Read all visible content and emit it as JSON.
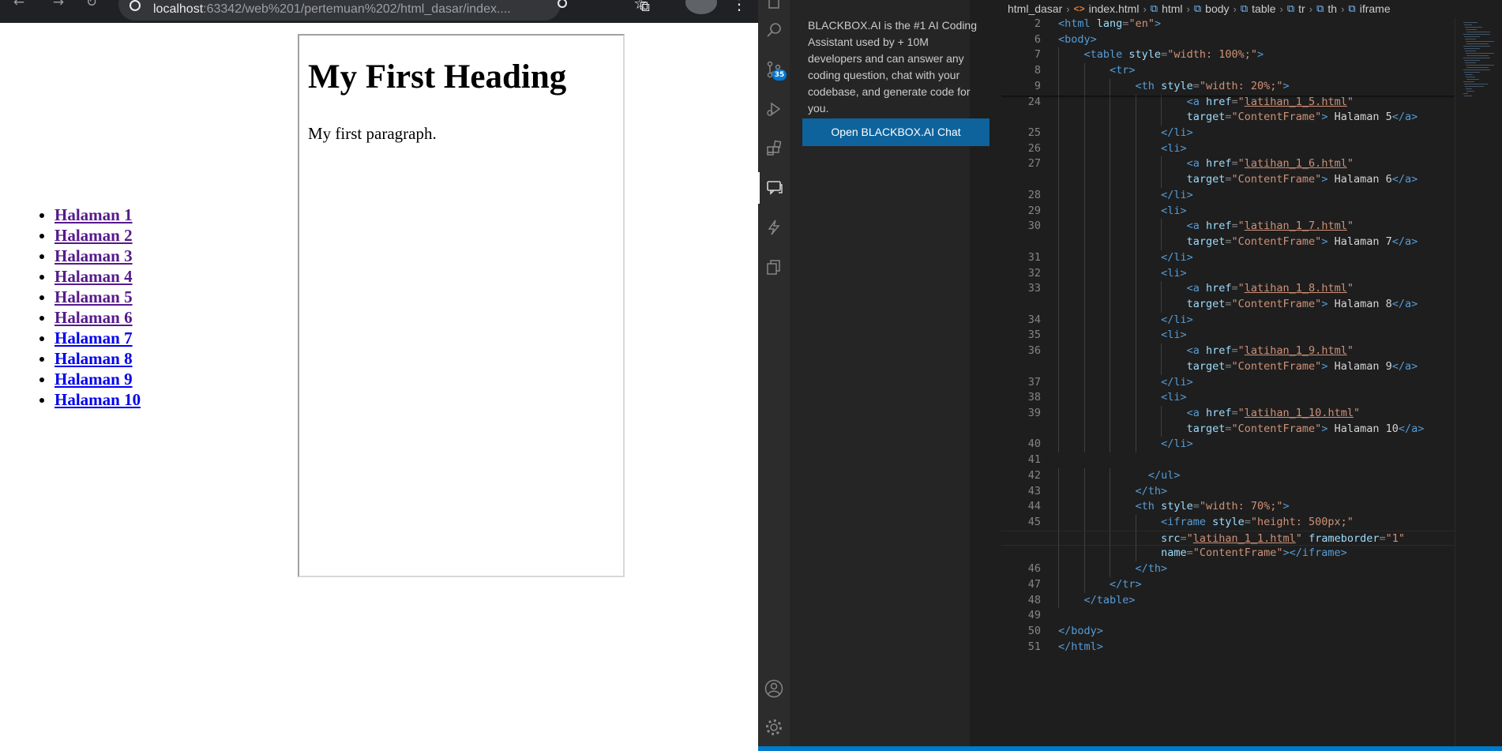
{
  "browser": {
    "url_host": "localhost",
    "url_rest": ":63342/web%201/pertemuan%202/html_dasar/index....",
    "nav_links": [
      {
        "label": "Halaman 1",
        "visited": true
      },
      {
        "label": "Halaman 2",
        "visited": true
      },
      {
        "label": "Halaman 3",
        "visited": true
      },
      {
        "label": "Halaman 4",
        "visited": true
      },
      {
        "label": "Halaman 5",
        "visited": true
      },
      {
        "label": "Halaman 6",
        "visited": true
      },
      {
        "label": "Halaman 7",
        "visited": false
      },
      {
        "label": "Halaman 8",
        "visited": false
      },
      {
        "label": "Halaman 9",
        "visited": false
      },
      {
        "label": "Halaman 10",
        "visited": false
      }
    ],
    "frame": {
      "heading": "My First Heading",
      "paragraph": "My first paragraph."
    }
  },
  "vscode": {
    "activity_bar": {
      "items": [
        "search-icon",
        "source-control-icon",
        "run-debug-icon",
        "extensions-icon",
        "blackbox-chat-icon",
        "lightning-icon",
        "copy-icon"
      ],
      "source_control_badge": "35",
      "bottom": [
        "account-icon",
        "settings-gear-icon"
      ]
    },
    "blackbox": {
      "description": "BLACKBOX.AI is the #1 AI Coding Assistant used by + 10M developers and can answer any coding question, chat with your codebase, and generate code for you.",
      "button_label": "Open BLACKBOX.AI Chat"
    },
    "breadcrumb": [
      "html_dasar",
      "index.html",
      "html",
      "body",
      "table",
      "tr",
      "th",
      "iframe"
    ],
    "code_lines": [
      {
        "n": "2",
        "indent": 0,
        "t": [
          [
            "t",
            "<html "
          ],
          [
            "a",
            "lang"
          ],
          [
            "p",
            "="
          ],
          [
            "s",
            "\"en\""
          ],
          [
            "t",
            ">"
          ]
        ]
      },
      {
        "n": "6",
        "indent": 0,
        "t": [
          [
            "t",
            "<body>"
          ]
        ]
      },
      {
        "n": "7",
        "indent": 1,
        "t": [
          [
            "t",
            "<table "
          ],
          [
            "a",
            "style"
          ],
          [
            "p",
            "="
          ],
          [
            "s",
            "\"width: 100%;\""
          ],
          [
            "t",
            ">"
          ]
        ]
      },
      {
        "n": "8",
        "indent": 2,
        "t": [
          [
            "t",
            "<tr>"
          ]
        ]
      },
      {
        "n": "9",
        "indent": 3,
        "t": [
          [
            "t",
            "<th "
          ],
          [
            "a",
            "style"
          ],
          [
            "p",
            "="
          ],
          [
            "s",
            "\"width: 20%;\""
          ],
          [
            "t",
            ">"
          ]
        ]
      },
      {
        "n": "24",
        "indent": 5,
        "t": [
          [
            "t",
            "<a "
          ],
          [
            "a",
            "href"
          ],
          [
            "p",
            "="
          ],
          [
            "s",
            "\""
          ],
          [
            "l",
            "latihan_1_5.html"
          ],
          [
            "s",
            "\""
          ]
        ]
      },
      {
        "n": "",
        "indent": 5,
        "t": [
          [
            "a",
            "target"
          ],
          [
            "p",
            "="
          ],
          [
            "s",
            "\"ContentFrame\""
          ],
          [
            "t",
            ">"
          ],
          [
            "x",
            " Halaman 5"
          ],
          [
            "t",
            "</a>"
          ]
        ]
      },
      {
        "n": "25",
        "indent": 4,
        "t": [
          [
            "t",
            "</li>"
          ]
        ]
      },
      {
        "n": "26",
        "indent": 4,
        "t": [
          [
            "t",
            "<li>"
          ]
        ]
      },
      {
        "n": "27",
        "indent": 5,
        "t": [
          [
            "t",
            "<a "
          ],
          [
            "a",
            "href"
          ],
          [
            "p",
            "="
          ],
          [
            "s",
            "\""
          ],
          [
            "l",
            "latihan_1_6.html"
          ],
          [
            "s",
            "\""
          ]
        ]
      },
      {
        "n": "",
        "indent": 5,
        "t": [
          [
            "a",
            "target"
          ],
          [
            "p",
            "="
          ],
          [
            "s",
            "\"ContentFrame\""
          ],
          [
            "t",
            ">"
          ],
          [
            "x",
            " Halaman 6"
          ],
          [
            "t",
            "</a>"
          ]
        ]
      },
      {
        "n": "28",
        "indent": 4,
        "t": [
          [
            "t",
            "</li>"
          ]
        ]
      },
      {
        "n": "29",
        "indent": 4,
        "t": [
          [
            "t",
            "<li>"
          ]
        ]
      },
      {
        "n": "30",
        "indent": 5,
        "t": [
          [
            "t",
            "<a "
          ],
          [
            "a",
            "href"
          ],
          [
            "p",
            "="
          ],
          [
            "s",
            "\""
          ],
          [
            "l",
            "latihan_1_7.html"
          ],
          [
            "s",
            "\""
          ]
        ]
      },
      {
        "n": "",
        "indent": 5,
        "t": [
          [
            "a",
            "target"
          ],
          [
            "p",
            "="
          ],
          [
            "s",
            "\"ContentFrame\""
          ],
          [
            "t",
            ">"
          ],
          [
            "x",
            " Halaman 7"
          ],
          [
            "t",
            "</a>"
          ]
        ]
      },
      {
        "n": "31",
        "indent": 4,
        "t": [
          [
            "t",
            "</li>"
          ]
        ]
      },
      {
        "n": "32",
        "indent": 4,
        "t": [
          [
            "t",
            "<li>"
          ]
        ]
      },
      {
        "n": "33",
        "indent": 5,
        "t": [
          [
            "t",
            "<a "
          ],
          [
            "a",
            "href"
          ],
          [
            "p",
            "="
          ],
          [
            "s",
            "\""
          ],
          [
            "l",
            "latihan_1_8.html"
          ],
          [
            "s",
            "\""
          ]
        ]
      },
      {
        "n": "",
        "indent": 5,
        "t": [
          [
            "a",
            "target"
          ],
          [
            "p",
            "="
          ],
          [
            "s",
            "\"ContentFrame\""
          ],
          [
            "t",
            ">"
          ],
          [
            "x",
            " Halaman 8"
          ],
          [
            "t",
            "</a>"
          ]
        ]
      },
      {
        "n": "34",
        "indent": 4,
        "t": [
          [
            "t",
            "</li>"
          ]
        ]
      },
      {
        "n": "35",
        "indent": 4,
        "t": [
          [
            "t",
            "<li>"
          ]
        ]
      },
      {
        "n": "36",
        "indent": 5,
        "t": [
          [
            "t",
            "<a "
          ],
          [
            "a",
            "href"
          ],
          [
            "p",
            "="
          ],
          [
            "s",
            "\""
          ],
          [
            "l",
            "latihan_1_9.html"
          ],
          [
            "s",
            "\""
          ]
        ]
      },
      {
        "n": "",
        "indent": 5,
        "t": [
          [
            "a",
            "target"
          ],
          [
            "p",
            "="
          ],
          [
            "s",
            "\"ContentFrame\""
          ],
          [
            "t",
            ">"
          ],
          [
            "x",
            " Halaman 9"
          ],
          [
            "t",
            "</a>"
          ]
        ]
      },
      {
        "n": "37",
        "indent": 4,
        "t": [
          [
            "t",
            "</li>"
          ]
        ]
      },
      {
        "n": "38",
        "indent": 4,
        "t": [
          [
            "t",
            "<li>"
          ]
        ]
      },
      {
        "n": "39",
        "indent": 5,
        "t": [
          [
            "t",
            "<a "
          ],
          [
            "a",
            "href"
          ],
          [
            "p",
            "="
          ],
          [
            "s",
            "\""
          ],
          [
            "l",
            "latihan_1_10.html"
          ],
          [
            "s",
            "\""
          ]
        ]
      },
      {
        "n": "",
        "indent": 5,
        "t": [
          [
            "a",
            "target"
          ],
          [
            "p",
            "="
          ],
          [
            "s",
            "\"ContentFrame\""
          ],
          [
            "t",
            ">"
          ],
          [
            "x",
            " Halaman 10"
          ],
          [
            "t",
            "</a>"
          ]
        ]
      },
      {
        "n": "40",
        "indent": 4,
        "t": [
          [
            "t",
            "</li>"
          ]
        ]
      },
      {
        "n": "41",
        "indent": 0,
        "t": []
      },
      {
        "n": "42",
        "indent": 3.5,
        "t": [
          [
            "t",
            "</ul>"
          ]
        ]
      },
      {
        "n": "43",
        "indent": 3,
        "t": [
          [
            "t",
            "</th>"
          ]
        ]
      },
      {
        "n": "44",
        "indent": 3,
        "t": [
          [
            "t",
            "<th "
          ],
          [
            "a",
            "style"
          ],
          [
            "p",
            "="
          ],
          [
            "s",
            "\"width: 70%;\""
          ],
          [
            "t",
            ">"
          ]
        ]
      },
      {
        "n": "45",
        "indent": 4,
        "t": [
          [
            "t",
            "<iframe "
          ],
          [
            "a",
            "style"
          ],
          [
            "p",
            "="
          ],
          [
            "s",
            "\"height: 500px;\""
          ]
        ]
      },
      {
        "n": "",
        "indent": 4,
        "current": true,
        "t": [
          [
            "a",
            "src"
          ],
          [
            "p",
            "="
          ],
          [
            "s",
            "\""
          ],
          [
            "l",
            "latihan_1_1.html"
          ],
          [
            "s",
            "\""
          ],
          [
            "x",
            " "
          ],
          [
            "a",
            "frameborder"
          ],
          [
            "p",
            "="
          ],
          [
            "s",
            "\"1\""
          ]
        ]
      },
      {
        "n": "",
        "indent": 4,
        "t": [
          [
            "a",
            "name"
          ],
          [
            "p",
            "="
          ],
          [
            "s",
            "\"ContentFrame\""
          ],
          [
            "t",
            "></iframe>"
          ]
        ]
      },
      {
        "n": "46",
        "indent": 3,
        "t": [
          [
            "t",
            "</th>"
          ]
        ]
      },
      {
        "n": "47",
        "indent": 2,
        "t": [
          [
            "t",
            "</tr>"
          ]
        ]
      },
      {
        "n": "48",
        "indent": 1,
        "t": [
          [
            "t",
            "</table>"
          ]
        ]
      },
      {
        "n": "49",
        "indent": 0,
        "t": []
      },
      {
        "n": "50",
        "indent": 0,
        "t": [
          [
            "t",
            "</body>"
          ]
        ]
      },
      {
        "n": "51",
        "indent": 0,
        "t": [
          [
            "t",
            "</html>"
          ]
        ]
      }
    ],
    "colors": {
      "tag": "#569cd6",
      "attribute": "#9cdcfe",
      "string": "#ce9178",
      "status_bar": "#007acc",
      "button": "#0e639c"
    }
  }
}
